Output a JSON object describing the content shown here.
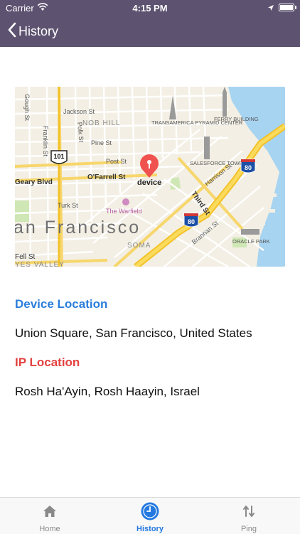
{
  "status": {
    "carrier": "Carrier",
    "time": "4:15 PM"
  },
  "nav": {
    "back_label": "History"
  },
  "map": {
    "pin_label": "device",
    "city_label": "an Francisco",
    "streets": [
      "Jackson St",
      "Pine St",
      "Post St",
      "O'Farrell St",
      "Geary Blvd",
      "Turk St",
      "Franklin St",
      "Polk St",
      "Gough St",
      "Third St",
      "Harrison St",
      "Brannan St",
      "Fell St"
    ],
    "neighborhoods": [
      "NOB HILL",
      "SOMA",
      "YES VALLEY"
    ],
    "landmarks": [
      "TRANSAMERICA PYRAMID CENTER",
      "FERRY BUILDING",
      "SALESFORCE TOWER",
      "The Warfield",
      "ORACLE PARK"
    ],
    "shields": [
      "101",
      "80",
      "80"
    ]
  },
  "device_location": {
    "title": "Device Location",
    "value": "Union Square, San Francisco, United States",
    "color": "#2a7ddb"
  },
  "ip_location": {
    "title": "IP Location",
    "value": "Rosh Ha'Ayin, Rosh Haayin, Israel",
    "color": "#e2413f"
  },
  "tabs": [
    {
      "label": "Home",
      "icon": "home-icon",
      "active": false
    },
    {
      "label": "History",
      "icon": "clock-icon",
      "active": true
    },
    {
      "label": "Ping",
      "icon": "up-down-arrows-icon",
      "active": false
    }
  ],
  "colors": {
    "navbar": "#5d5270",
    "tab_active": "#2479e1",
    "tab_inactive": "#8a8a8a"
  }
}
